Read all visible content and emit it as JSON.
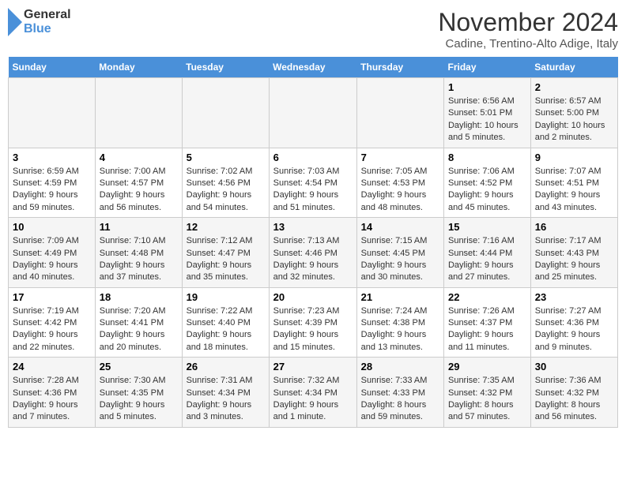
{
  "header": {
    "logo_line1": "General",
    "logo_line2": "Blue",
    "month_title": "November 2024",
    "subtitle": "Cadine, Trentino-Alto Adige, Italy"
  },
  "days_of_week": [
    "Sunday",
    "Monday",
    "Tuesday",
    "Wednesday",
    "Thursday",
    "Friday",
    "Saturday"
  ],
  "weeks": [
    [
      {
        "day": "",
        "info": ""
      },
      {
        "day": "",
        "info": ""
      },
      {
        "day": "",
        "info": ""
      },
      {
        "day": "",
        "info": ""
      },
      {
        "day": "",
        "info": ""
      },
      {
        "day": "1",
        "info": "Sunrise: 6:56 AM\nSunset: 5:01 PM\nDaylight: 10 hours and 5 minutes."
      },
      {
        "day": "2",
        "info": "Sunrise: 6:57 AM\nSunset: 5:00 PM\nDaylight: 10 hours and 2 minutes."
      }
    ],
    [
      {
        "day": "3",
        "info": "Sunrise: 6:59 AM\nSunset: 4:59 PM\nDaylight: 9 hours and 59 minutes."
      },
      {
        "day": "4",
        "info": "Sunrise: 7:00 AM\nSunset: 4:57 PM\nDaylight: 9 hours and 56 minutes."
      },
      {
        "day": "5",
        "info": "Sunrise: 7:02 AM\nSunset: 4:56 PM\nDaylight: 9 hours and 54 minutes."
      },
      {
        "day": "6",
        "info": "Sunrise: 7:03 AM\nSunset: 4:54 PM\nDaylight: 9 hours and 51 minutes."
      },
      {
        "day": "7",
        "info": "Sunrise: 7:05 AM\nSunset: 4:53 PM\nDaylight: 9 hours and 48 minutes."
      },
      {
        "day": "8",
        "info": "Sunrise: 7:06 AM\nSunset: 4:52 PM\nDaylight: 9 hours and 45 minutes."
      },
      {
        "day": "9",
        "info": "Sunrise: 7:07 AM\nSunset: 4:51 PM\nDaylight: 9 hours and 43 minutes."
      }
    ],
    [
      {
        "day": "10",
        "info": "Sunrise: 7:09 AM\nSunset: 4:49 PM\nDaylight: 9 hours and 40 minutes."
      },
      {
        "day": "11",
        "info": "Sunrise: 7:10 AM\nSunset: 4:48 PM\nDaylight: 9 hours and 37 minutes."
      },
      {
        "day": "12",
        "info": "Sunrise: 7:12 AM\nSunset: 4:47 PM\nDaylight: 9 hours and 35 minutes."
      },
      {
        "day": "13",
        "info": "Sunrise: 7:13 AM\nSunset: 4:46 PM\nDaylight: 9 hours and 32 minutes."
      },
      {
        "day": "14",
        "info": "Sunrise: 7:15 AM\nSunset: 4:45 PM\nDaylight: 9 hours and 30 minutes."
      },
      {
        "day": "15",
        "info": "Sunrise: 7:16 AM\nSunset: 4:44 PM\nDaylight: 9 hours and 27 minutes."
      },
      {
        "day": "16",
        "info": "Sunrise: 7:17 AM\nSunset: 4:43 PM\nDaylight: 9 hours and 25 minutes."
      }
    ],
    [
      {
        "day": "17",
        "info": "Sunrise: 7:19 AM\nSunset: 4:42 PM\nDaylight: 9 hours and 22 minutes."
      },
      {
        "day": "18",
        "info": "Sunrise: 7:20 AM\nSunset: 4:41 PM\nDaylight: 9 hours and 20 minutes."
      },
      {
        "day": "19",
        "info": "Sunrise: 7:22 AM\nSunset: 4:40 PM\nDaylight: 9 hours and 18 minutes."
      },
      {
        "day": "20",
        "info": "Sunrise: 7:23 AM\nSunset: 4:39 PM\nDaylight: 9 hours and 15 minutes."
      },
      {
        "day": "21",
        "info": "Sunrise: 7:24 AM\nSunset: 4:38 PM\nDaylight: 9 hours and 13 minutes."
      },
      {
        "day": "22",
        "info": "Sunrise: 7:26 AM\nSunset: 4:37 PM\nDaylight: 9 hours and 11 minutes."
      },
      {
        "day": "23",
        "info": "Sunrise: 7:27 AM\nSunset: 4:36 PM\nDaylight: 9 hours and 9 minutes."
      }
    ],
    [
      {
        "day": "24",
        "info": "Sunrise: 7:28 AM\nSunset: 4:36 PM\nDaylight: 9 hours and 7 minutes."
      },
      {
        "day": "25",
        "info": "Sunrise: 7:30 AM\nSunset: 4:35 PM\nDaylight: 9 hours and 5 minutes."
      },
      {
        "day": "26",
        "info": "Sunrise: 7:31 AM\nSunset: 4:34 PM\nDaylight: 9 hours and 3 minutes."
      },
      {
        "day": "27",
        "info": "Sunrise: 7:32 AM\nSunset: 4:34 PM\nDaylight: 9 hours and 1 minute."
      },
      {
        "day": "28",
        "info": "Sunrise: 7:33 AM\nSunset: 4:33 PM\nDaylight: 8 hours and 59 minutes."
      },
      {
        "day": "29",
        "info": "Sunrise: 7:35 AM\nSunset: 4:32 PM\nDaylight: 8 hours and 57 minutes."
      },
      {
        "day": "30",
        "info": "Sunrise: 7:36 AM\nSunset: 4:32 PM\nDaylight: 8 hours and 56 minutes."
      }
    ]
  ]
}
